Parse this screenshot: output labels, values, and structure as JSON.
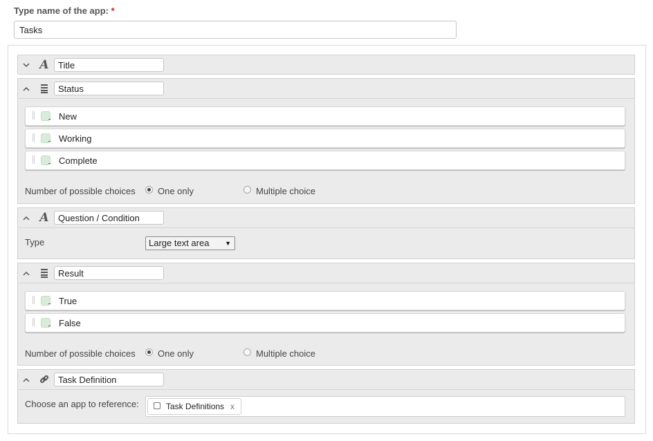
{
  "app": {
    "label": "Type name of the app:",
    "required_mark": "*",
    "name": "Tasks"
  },
  "fields": {
    "title": {
      "name": "Title",
      "icon": "text-icon",
      "collapsed": true
    },
    "status": {
      "name": "Status",
      "icon": "list-icon",
      "options": [
        "New",
        "Working",
        "Complete"
      ],
      "choices_label": "Number of possible choices",
      "one_only": "One only",
      "multiple": "Multiple choice",
      "selected": "One only"
    },
    "question": {
      "name": "Question / Condition",
      "icon": "text-icon",
      "type_label": "Type",
      "type_value": "Large text area"
    },
    "result": {
      "name": "Result",
      "icon": "list-icon",
      "options": [
        "True",
        "False"
      ],
      "choices_label": "Number of possible choices",
      "one_only": "One only",
      "multiple": "Multiple choice",
      "selected": "One only"
    },
    "taskdef": {
      "name": "Task Definition",
      "icon": "link-icon",
      "ref_label": "Choose an app to reference:",
      "ref_chip": "Task Definitions",
      "ref_remove": "x"
    }
  },
  "colors": {
    "required": "#cc2222",
    "field_bg": "#ebebeb",
    "swatch": "#d9ecd9"
  }
}
